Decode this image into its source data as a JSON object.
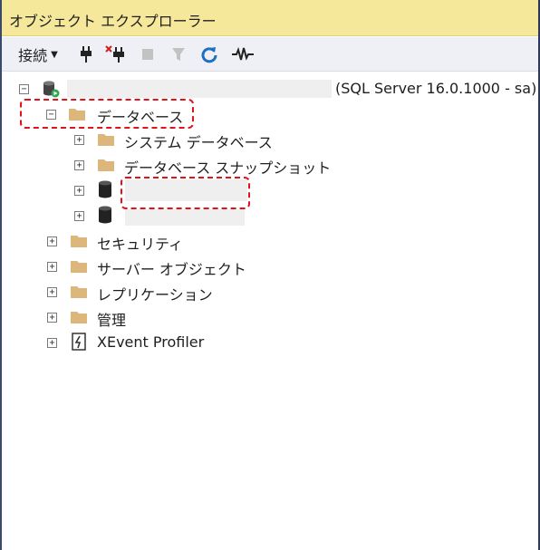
{
  "window": {
    "title": "オブジェクト エクスプローラー"
  },
  "toolbar": {
    "connect_label": "接続",
    "icons": [
      "connect-plug-icon",
      "disconnect-plug-icon",
      "stop-icon",
      "filter-icon",
      "refresh-icon",
      "activity-monitor-icon"
    ]
  },
  "tree": {
    "server": {
      "name": "",
      "suffix": "(SQL Server 16.0.1000 - sa)"
    },
    "databases": {
      "label": "データベース",
      "children": [
        {
          "label": "システム データベース",
          "icon": "folder-icon"
        },
        {
          "label": "データベース スナップショット",
          "icon": "folder-icon"
        },
        {
          "label": "",
          "icon": "database-icon"
        },
        {
          "label": "",
          "icon": "database-icon"
        }
      ]
    },
    "top_level": [
      {
        "label": "セキュリティ",
        "icon": "folder-icon"
      },
      {
        "label": "サーバー オブジェクト",
        "icon": "folder-icon"
      },
      {
        "label": "レプリケーション",
        "icon": "folder-icon"
      },
      {
        "label": "管理",
        "icon": "folder-icon"
      },
      {
        "label": "XEvent Profiler",
        "icon": "xevent-icon"
      }
    ]
  },
  "colors": {
    "title_bg": "#f5e89a",
    "highlight": "#e0121a",
    "folder": "#dcb67a",
    "refresh": "#1e6fbf"
  }
}
